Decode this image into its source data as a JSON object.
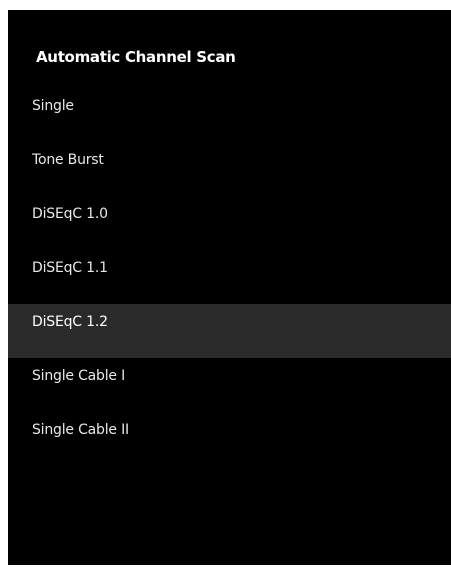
{
  "menu": {
    "title": "Automatic Channel Scan",
    "items": [
      {
        "label": "Single"
      },
      {
        "label": "Tone Burst"
      },
      {
        "label": "DiSEqC 1.0"
      },
      {
        "label": "DiSEqC 1.1"
      },
      {
        "label": "DiSEqC 1.2"
      },
      {
        "label": "Single Cable I"
      },
      {
        "label": "Single Cable II"
      }
    ],
    "selected_label": "DiSEqC 1.2"
  },
  "colors": {
    "background": "#000000",
    "highlight": "#2a2a2a",
    "text": "#ffffff"
  }
}
